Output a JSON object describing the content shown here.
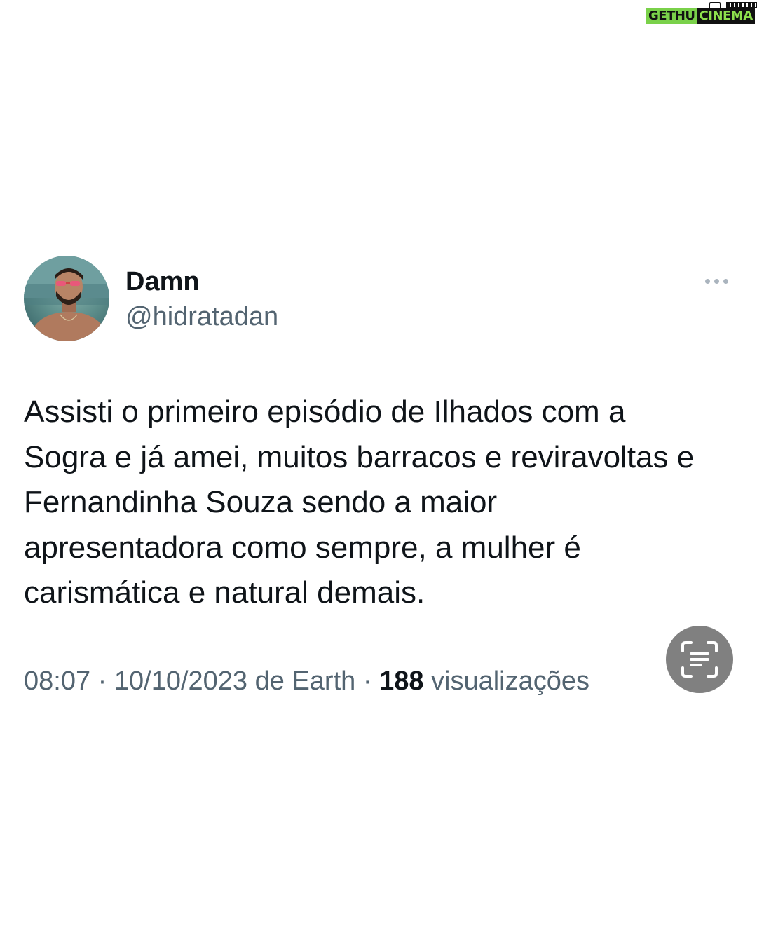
{
  "watermark": {
    "left": "GETHU",
    "right": "CINEMA"
  },
  "tweet": {
    "display_name": "Damn",
    "handle": "@hidratadan",
    "more_icon": "ellipsis-icon",
    "text_lines": [
      "Assisti o primeiro episódio de Ilhados com a",
      "Sogra e já amei, muitos barracos e reviravoltas e",
      "Fernandinha Souza sendo a maior",
      "apresentadora como sempre, a mulher é",
      "carismática e natural demais."
    ],
    "meta": {
      "time": "08:07",
      "separator": " · ",
      "date": "10/10/2023",
      "source": " de Earth",
      "views_count": "188",
      "views_label": " visualizações"
    }
  },
  "scan_button": {
    "icon": "text-scan-icon"
  },
  "colors": {
    "text_primary": "#0f1419",
    "text_secondary": "#536471",
    "scan_button_bg": "#808080",
    "watermark_green": "#7ad14a"
  }
}
